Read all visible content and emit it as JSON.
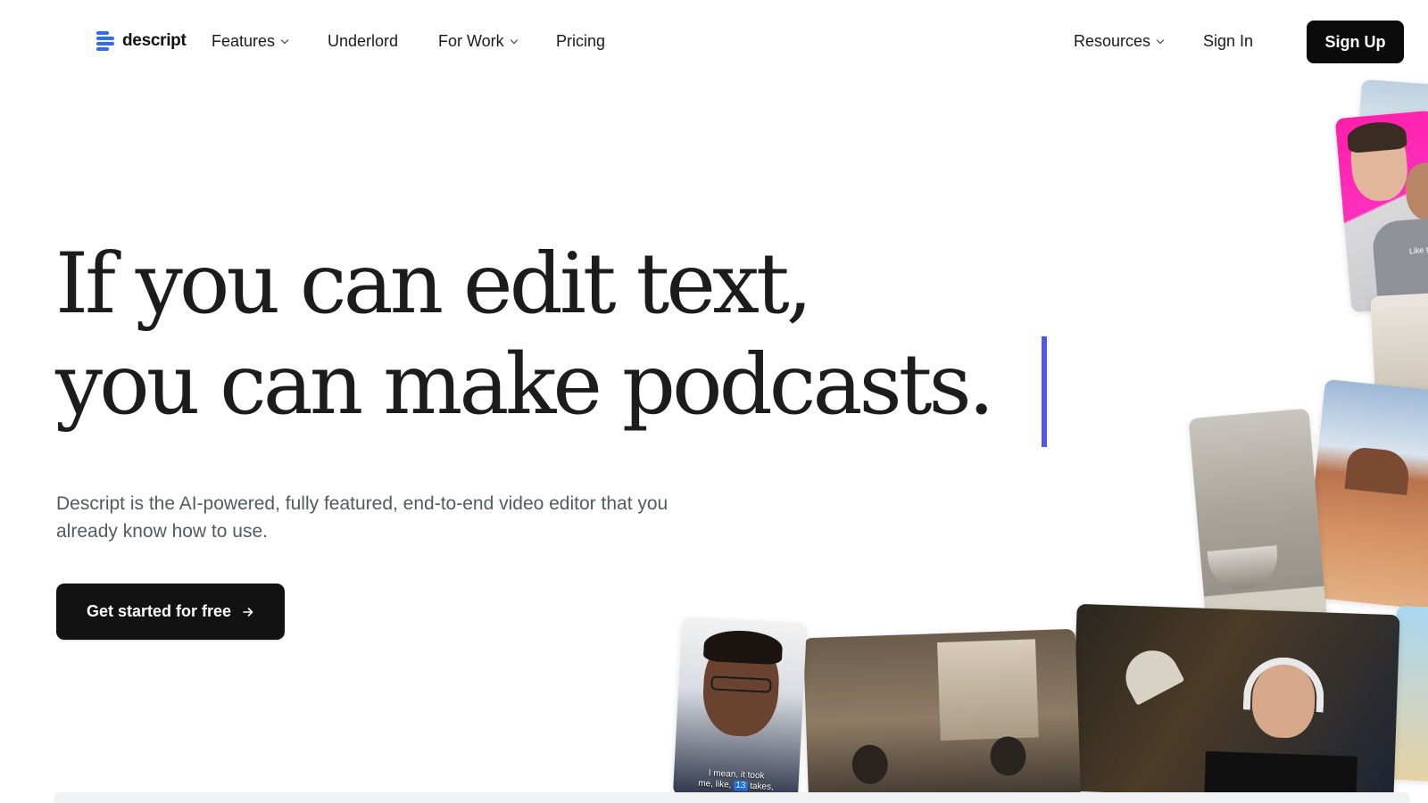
{
  "nav": {
    "logo_text": "descript",
    "features": "Features",
    "underlord": "Underlord",
    "for_work": "For Work",
    "pricing": "Pricing",
    "resources": "Resources",
    "sign_in": "Sign In",
    "sign_up": "Sign Up"
  },
  "hero": {
    "headline_line1": "If you can edit text,",
    "headline_line2": "you can make podcasts.",
    "subtitle": "Descript is the AI-powered, fully featured, end-to-end video editor that you already know how to use.",
    "cta_label": "Get started for free",
    "cta_icon": "arrow-right-icon"
  },
  "media": {
    "caption_line1": "I mean, it took",
    "caption_pre": "me, like, ",
    "caption_highlight": "13",
    "caption_post": " takes,",
    "tshirt_text": "Like tha"
  },
  "colors": {
    "accent": "#4c57f5",
    "brand_logo": "#2f6bff",
    "button_dark": "#121212"
  }
}
